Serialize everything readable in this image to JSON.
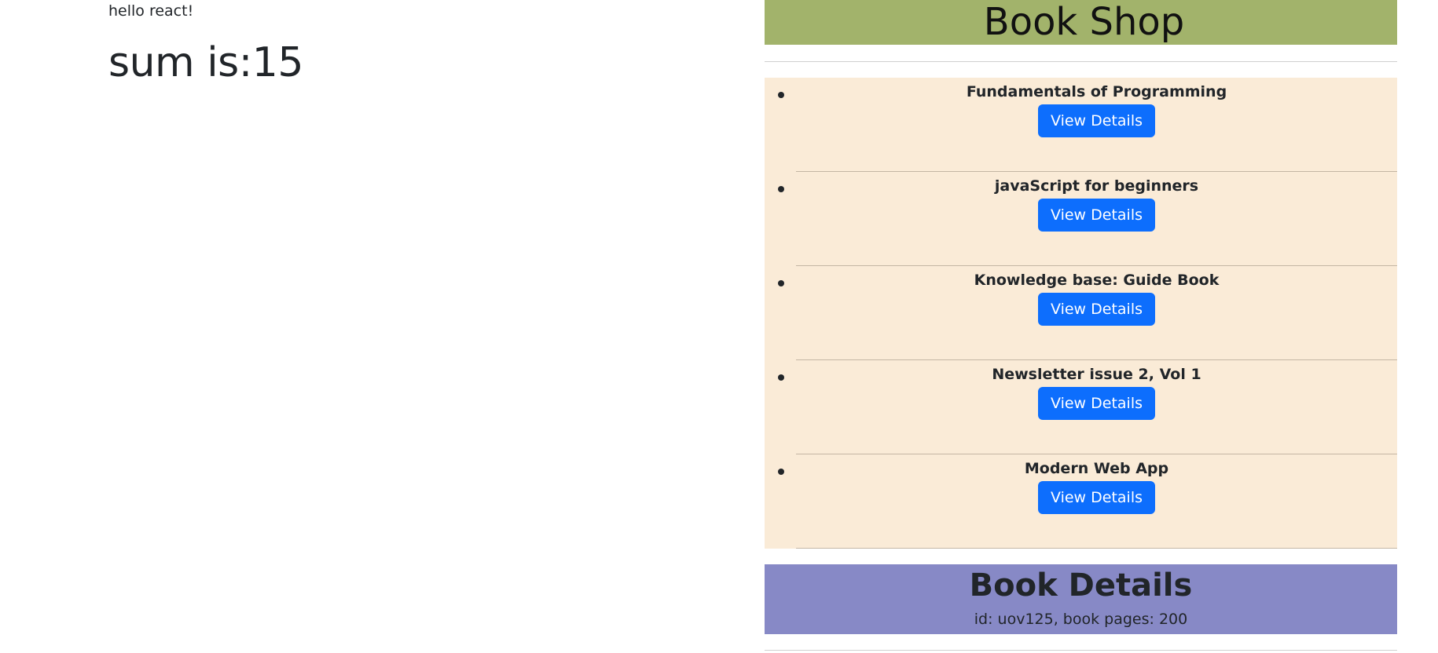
{
  "left": {
    "greeting": "hello react!",
    "sum_text": "sum is:15"
  },
  "shop": {
    "title": "Book Shop",
    "header_color": "#a2b36b",
    "list_background": "#faebd7",
    "books": [
      {
        "title": "Fundamentals of Programming",
        "button_label": "View Details"
      },
      {
        "title": "javaScript for beginners",
        "button_label": "View Details"
      },
      {
        "title": "Knowledge base: Guide Book",
        "button_label": "View Details"
      },
      {
        "title": "Newsletter issue 2, Vol 1",
        "button_label": "View Details"
      },
      {
        "title": "Modern Web App",
        "button_label": "View Details"
      }
    ],
    "button_color": "#0d6efd"
  },
  "details": {
    "title": "Book Details",
    "info": "id: uov125, book pages: 200",
    "background": "#8789c6"
  }
}
